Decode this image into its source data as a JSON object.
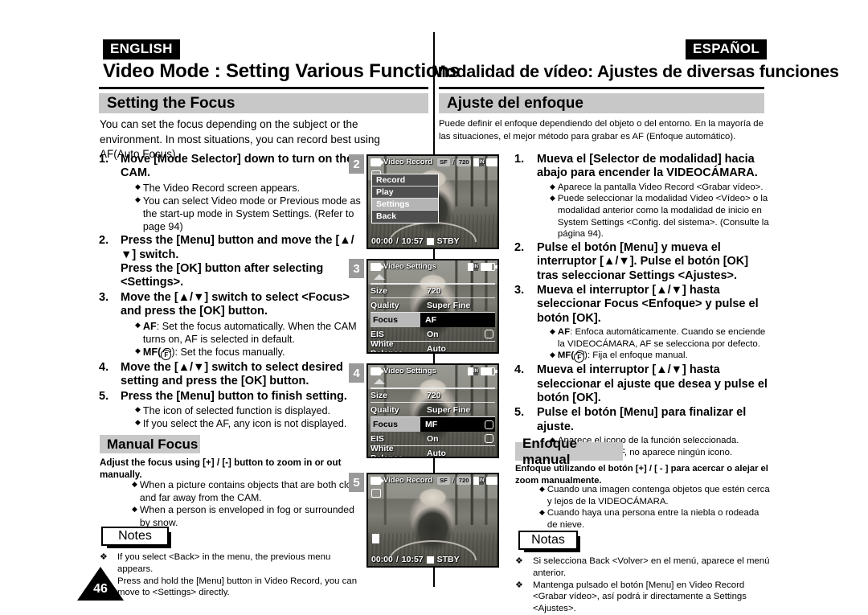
{
  "language_badges": {
    "english": "ENGLISH",
    "spanish": "ESPAÑOL"
  },
  "chapter": {
    "english": "Video Mode : Setting Various Functions",
    "spanish": "Modalidad de vídeo: Ajustes de diversas funciones"
  },
  "section": {
    "english": "Setting the Focus",
    "spanish": "Ajuste del enfoque"
  },
  "intro": {
    "english": "You can set the focus depending on the subject or the environment. In most situations, you can record best using AF(Auto Focus).",
    "spanish": "Puede definir el enfoque dependiendo del objeto o del entorno. En la mayoría de las situaciones, el mejor método para grabar es AF (Enfoque automático)."
  },
  "steps_en": [
    {
      "num": "1.",
      "lead": "Move [Mode Selector] down to turn on the CAM.",
      "bullets": [
        {
          "text": "The Video Record screen appears."
        },
        {
          "text": "You can select Video mode or Previous mode as the start-up mode in System Settings. (Refer to page 94)"
        }
      ]
    },
    {
      "num": "2.",
      "lead": "Press the [Menu] button and move the [▲/▼] switch.",
      "lead2": "Press the [OK] button after selecting <Settings>.",
      "bullets": []
    },
    {
      "num": "3.",
      "lead": "Move the [▲/▼] switch to select <Focus> and press the [OK] button.",
      "bullets": [
        {
          "bold": "AF",
          "text": ": Set the focus automatically. When the CAM turns on, AF is selected in default."
        },
        {
          "bold": "MF",
          "icon": "mf-hand-icon",
          "text": "): Set the focus manually.",
          "prefix_paren": "("
        }
      ]
    },
    {
      "num": "4.",
      "lead": "Move the [▲/▼] switch to select desired setting and press the [OK] button.",
      "bullets": []
    },
    {
      "num": "5.",
      "lead": "Press the [Menu] button to finish setting.",
      "bullets": [
        {
          "text": "The icon of selected function is displayed."
        },
        {
          "text": "If you select the AF, any icon is not displayed."
        }
      ]
    }
  ],
  "steps_es": [
    {
      "num": "1.",
      "lead": "Mueva el [Selector de modalidad] hacia abajo para encender la VIDEOCÁMARA.",
      "bullets": [
        {
          "text": "Aparece la pantalla Video Record <Grabar vídeo>."
        },
        {
          "text": "Puede seleccionar la modalidad Video <Vídeo> o la modalidad anterior como la modalidad de inicio en System Settings <Config. del sistema>. (Consulte la página 94)."
        }
      ]
    },
    {
      "num": "2.",
      "lead": "Pulse el botón [Menu] y mueva el interruptor [▲/▼]. Pulse el botón [OK] tras seleccionar Settings <Ajustes>.",
      "bullets": []
    },
    {
      "num": "3.",
      "lead": "Mueva el interruptor [▲/▼] hasta seleccionar Focus <Enfoque> y pulse el botón [OK].",
      "bullets": [
        {
          "bold": "AF",
          "text": ": Enfoca automáticamente. Cuando se enciende la VIDEOCÁMARA, AF se selecciona por defecto."
        },
        {
          "bold": "MF",
          "icon": "mf-hand-icon",
          "text": "): Fija el enfoque manual.",
          "prefix_paren": "("
        }
      ]
    },
    {
      "num": "4.",
      "lead": "Mueva el interruptor [▲/▼] hasta seleccionar el ajuste que desea y pulse el botón [OK].",
      "bullets": []
    },
    {
      "num": "5.",
      "lead": "Pulse el botón [Menu] para finalizar el ajuste.",
      "bullets": [
        {
          "text": "Aparece el icono de la función seleccionada."
        },
        {
          "text": "Si selecciona AF, no aparece ningún icono."
        }
      ]
    }
  ],
  "subsection": {
    "english": {
      "title": "Manual Focus",
      "intro": "Adjust the focus using [+] / [-] button to zoom in or out manually.",
      "bullets": [
        "When a picture contains objects that are both close and far away from the CAM.",
        "When a person is enveloped in fog or surrounded by snow."
      ]
    },
    "spanish": {
      "title": "Enfoque manual",
      "intro": "Enfoque utilizando el botón [+] / [ - ] para acercar o alejar el zoom manualmente.",
      "bullets": [
        "Cuando una imagen contenga objetos que estén cerca y lejos de la VIDEOCÁMARA.",
        "Cuando haya una persona entre la niebla o rodeada de nieve."
      ]
    }
  },
  "notes": {
    "english": {
      "label": "Notes",
      "items": [
        "If you select <Back> in the menu, the previous menu appears.",
        "Press and hold the [Menu] button in Video Record, you can move to <Settings> directly."
      ]
    },
    "spanish": {
      "label": "Notas",
      "items": [
        "Si selecciona Back <Volver> en el menú, aparece el menú anterior.",
        "Mantenga pulsado el botón [Menu] en Video Record <Grabar vídeo>, así podrá ir directamente a Settings <Ajustes>."
      ]
    }
  },
  "page_number": "46",
  "screens": [
    {
      "step_badge": "2",
      "mode_title": "Video Record",
      "top_tags": {
        "quality": "SF",
        "size": "720"
      },
      "menu": [
        {
          "label": "Record",
          "selected": false
        },
        {
          "label": "Play",
          "selected": false
        },
        {
          "label": "Settings",
          "selected": true
        },
        {
          "label": "Back",
          "selected": false
        }
      ],
      "bottom": {
        "elapsed": "00:00",
        "remaining": "10:57",
        "status": "STBY"
      }
    },
    {
      "step_badge": "3",
      "mode_title": "Video Settings",
      "rows": [
        {
          "key": "Size",
          "value": "720",
          "highlighted": false
        },
        {
          "key": "Quality",
          "value": "Super Fine",
          "highlighted": false
        },
        {
          "key": "Focus",
          "value": "AF",
          "highlighted": true
        },
        {
          "key": "EIS",
          "value": "On",
          "highlighted": false,
          "icon": "hand-icon"
        },
        {
          "key": "White Balance",
          "value": "Auto",
          "highlighted": false
        }
      ]
    },
    {
      "step_badge": "4",
      "mode_title": "Video Settings",
      "rows": [
        {
          "key": "Size",
          "value": "720",
          "highlighted": false
        },
        {
          "key": "Quality",
          "value": "Super Fine",
          "highlighted": false
        },
        {
          "key": "Focus",
          "value": "MF",
          "highlighted": true,
          "icon": "mf-hand-icon"
        },
        {
          "key": "EIS",
          "value": "On",
          "highlighted": false,
          "icon": "hand-icon"
        },
        {
          "key": "White Balance",
          "value": "Auto",
          "highlighted": false
        }
      ]
    },
    {
      "step_badge": "5",
      "mode_title": "Video Record",
      "top_tags": {
        "quality": "SF",
        "size": "720"
      },
      "bottom": {
        "elapsed": "00:00",
        "remaining": "10:57",
        "status": "STBY"
      }
    }
  ],
  "colors": {
    "section_bar": "#c8c8c8",
    "badge_bg": "#000000",
    "step_badge_bg": "#9a9a9a",
    "lcd_menu_selected": "#b4b4b4"
  }
}
